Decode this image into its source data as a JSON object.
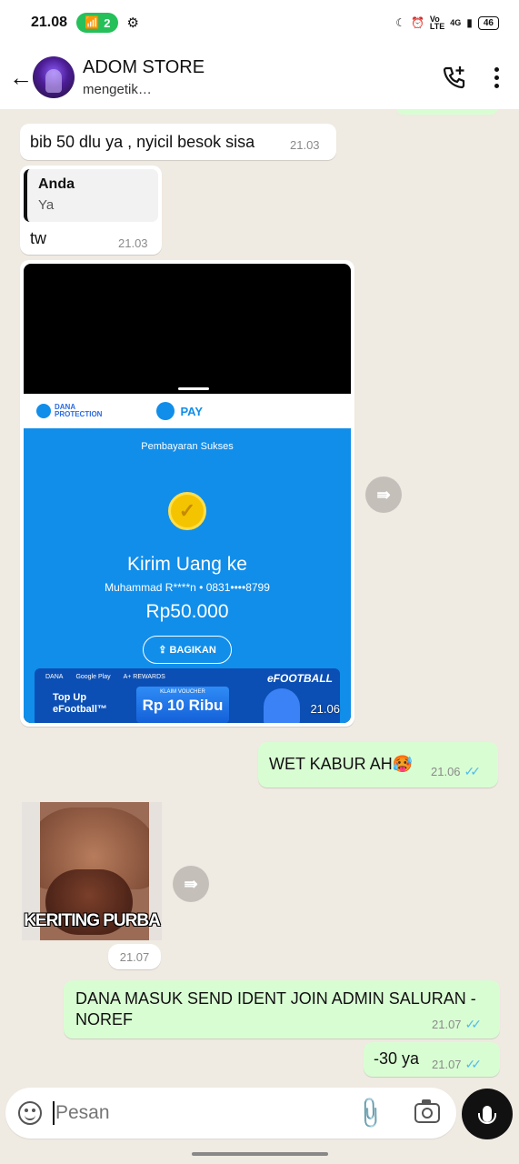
{
  "status_bar": {
    "time": "21.08",
    "hotspot_count": "2",
    "signal_label_top": "Vo",
    "signal_label_bottom": "LTE",
    "network_label": "4G",
    "battery": "46"
  },
  "header": {
    "contact_name": "ADOM STORE",
    "contact_status": "mengetik…"
  },
  "messages": [
    {
      "text": "bib 50 dlu ya , nyicil besok sisa",
      "time": "21.03"
    },
    {
      "quote_name": "Anda",
      "quote_text": "Ya",
      "text": "tw",
      "time": "21.03"
    },
    {
      "image": {
        "dana_protection": "DANA\nPROTECTION",
        "pay_label": "PAY",
        "status": "Pembayaran Sukses",
        "title": "Kirim Uang ke",
        "recipient": "Muhammad R****n • 0831••••8799",
        "amount": "Rp50.000",
        "share_label": "BAGIKAN",
        "banner_partners": [
          "DANA",
          "Google Play",
          "A+ REWARDS"
        ],
        "banner_brand": "eFOOTBALL",
        "banner_topup": "Top Up\neFootball™",
        "banner_voucher_label": "KLAIM VOUCHER",
        "banner_voucher_value": "Rp 10 Ribu"
      },
      "time": "21.06"
    },
    {
      "text": "WET KABUR AH🥵",
      "time": "21.06"
    },
    {
      "sticker_caption": "KERITING PURBA",
      "time": "21.07"
    },
    {
      "text": "DANA MASUK SEND IDENT JOIN ADMIN SALURAN -NOREF",
      "time": "21.07"
    },
    {
      "text": "-30 ya",
      "time": "21.07"
    }
  ],
  "composer": {
    "placeholder": "Pesan"
  },
  "colors": {
    "outgoing_bubble": "#d9fdd3",
    "incoming_bubble": "#ffffff",
    "chat_background": "#efeae2",
    "read_ticks": "#53bdeb",
    "dana_blue": "#118eea"
  },
  "icons": [
    "back-arrow-icon",
    "add-call-icon",
    "more-vert-icon",
    "forward-icon",
    "emoji-icon",
    "attach-icon",
    "camera-icon",
    "mic-icon",
    "double-check-icon"
  ]
}
